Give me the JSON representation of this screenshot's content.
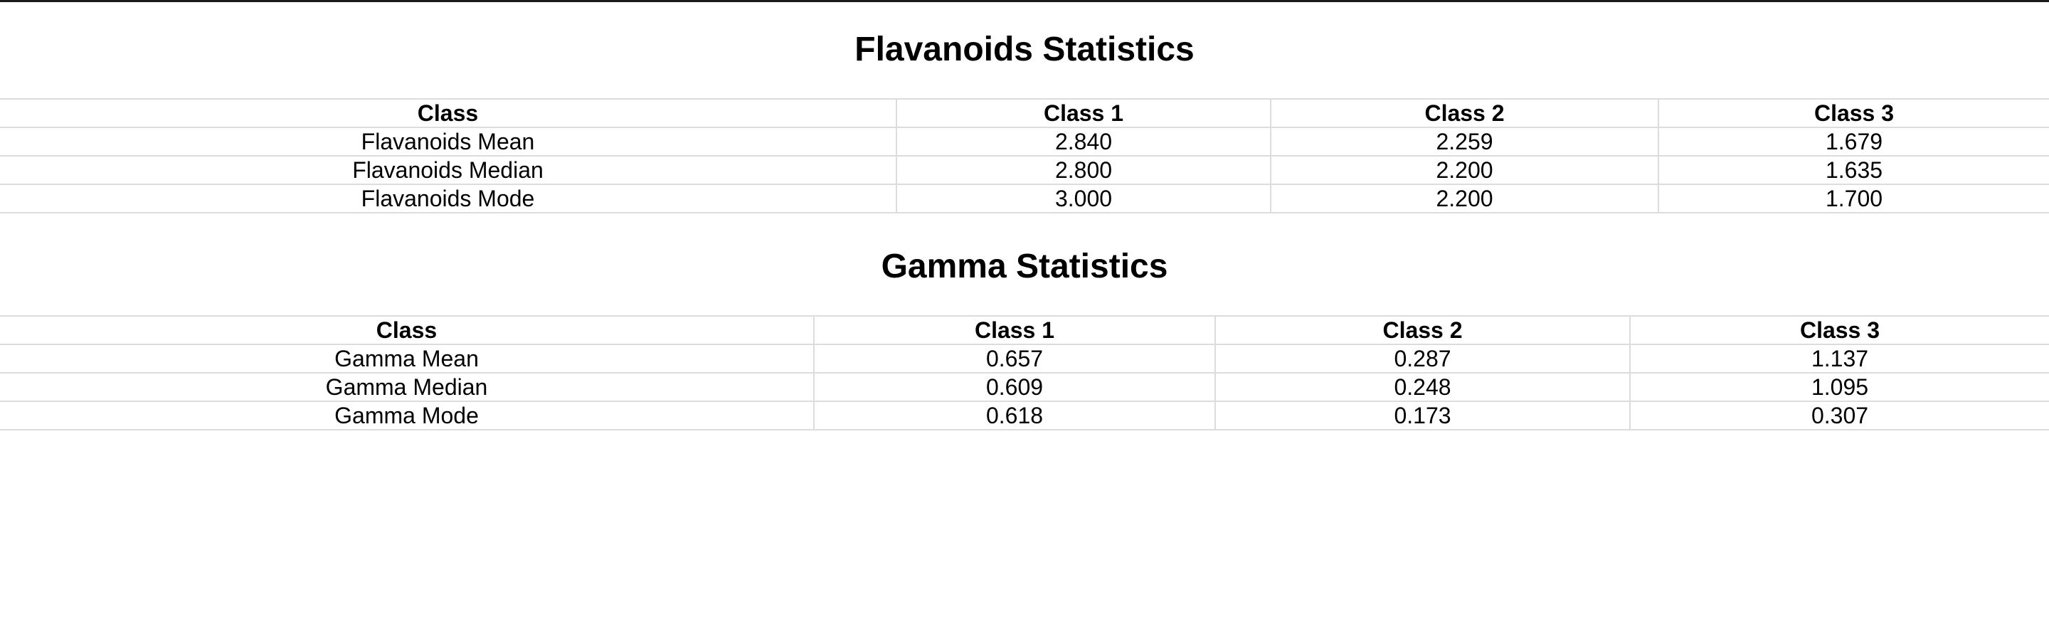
{
  "flavanoids": {
    "title": "Flavanoids Statistics",
    "headers": [
      "Class",
      "Class 1",
      "Class 2",
      "Class 3"
    ],
    "rows": [
      [
        "Flavanoids Mean",
        "2.840",
        "2.259",
        "1.679"
      ],
      [
        "Flavanoids Median",
        "2.800",
        "2.200",
        "1.635"
      ],
      [
        "Flavanoids Mode",
        "3.000",
        "2.200",
        "1.700"
      ]
    ]
  },
  "gamma": {
    "title": "Gamma Statistics",
    "headers": [
      "Class",
      "Class 1",
      "Class 2",
      "Class 3"
    ],
    "rows": [
      [
        "Gamma Mean",
        "0.657",
        "0.287",
        "1.137"
      ],
      [
        "Gamma Median",
        "0.609",
        "0.248",
        "1.095"
      ],
      [
        "Gamma Mode",
        "0.618",
        "0.173",
        "0.307"
      ]
    ]
  }
}
